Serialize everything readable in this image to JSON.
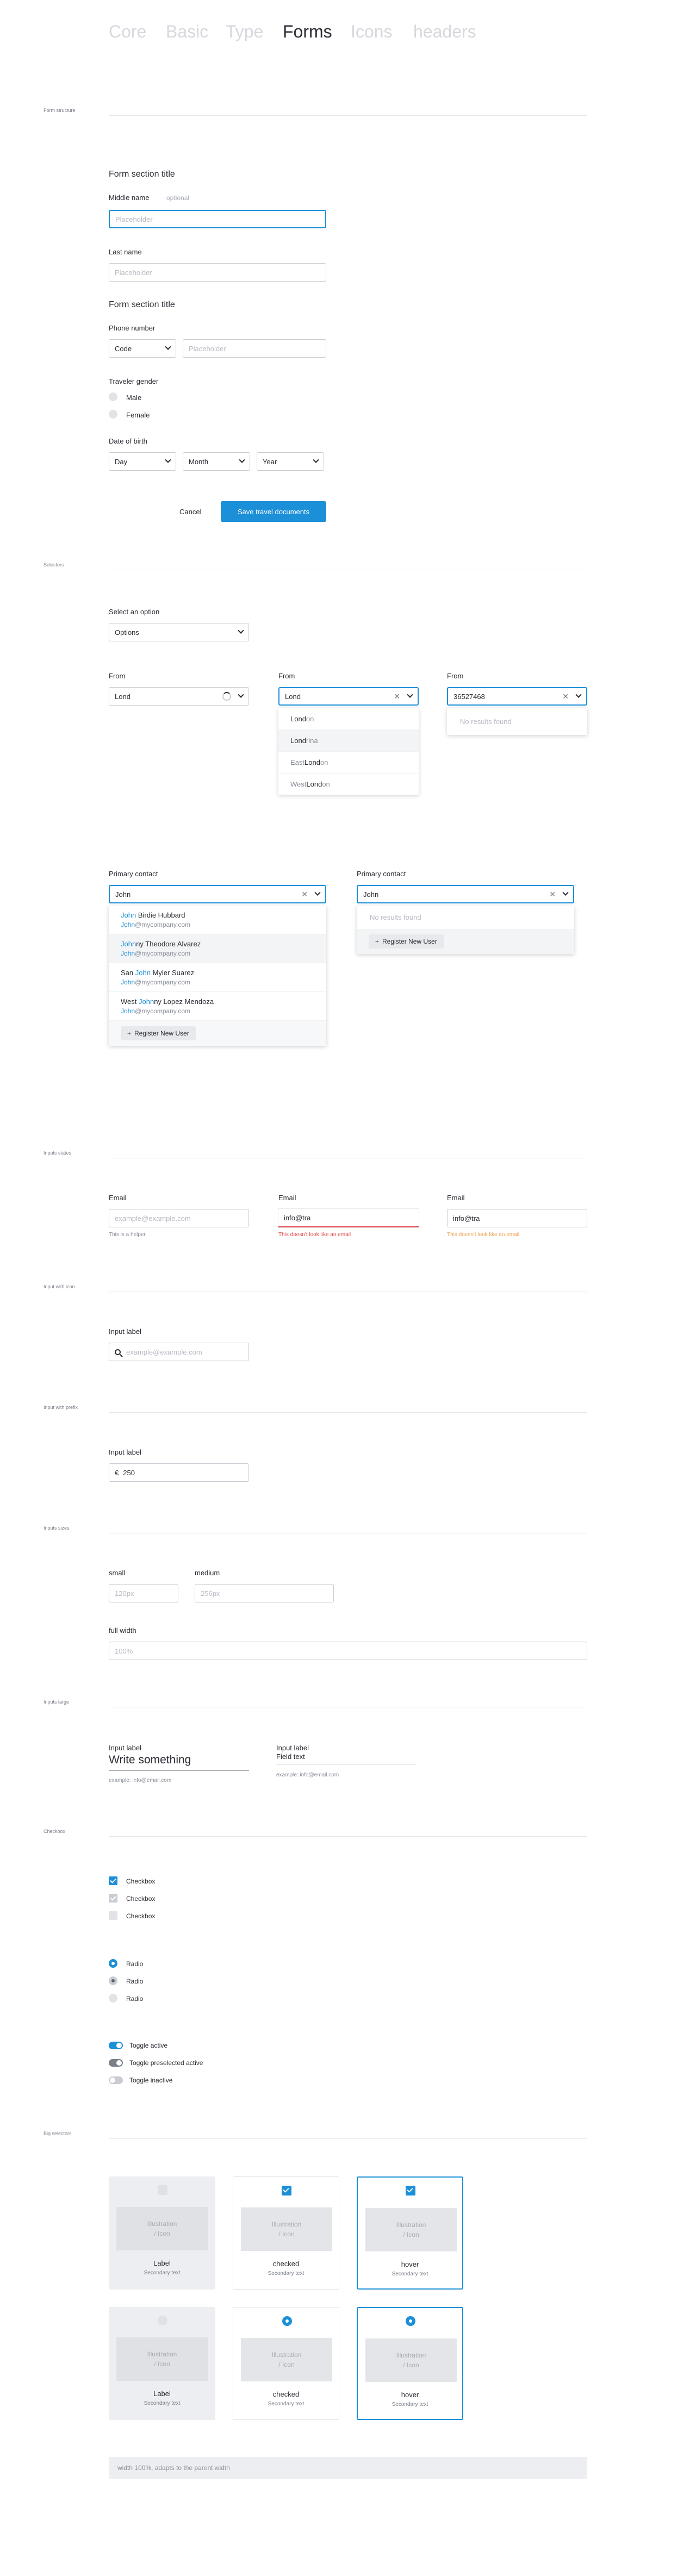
{
  "nav": {
    "tabs": [
      "Core",
      "Basic",
      "Type",
      "Forms",
      "Icons",
      "headers"
    ],
    "active": "Forms"
  },
  "sections": {
    "form_structure": "Form structure",
    "selectors": "Selectors",
    "inputs_states": "Inputs states",
    "input_with_icon": "Input with icon",
    "input_with_prefix": "Input with prefix",
    "inputs_sizes": "Inputs sizes",
    "inputs_large": "Inputs large",
    "checkbox": "Checkbox",
    "big_selectors": "Big selectors"
  },
  "form": {
    "section_title_1": "Form section title",
    "middle_name_label": "Middle name",
    "optional": "optional",
    "placeholder": "Placeholder",
    "last_name_label": "Last name",
    "section_title_2": "Form section title",
    "phone_label": "Phone number",
    "code": "Code",
    "gender_label": "Traveler gender",
    "male": "Male",
    "female": "Female",
    "dob_label": "Date of birth",
    "day": "Day",
    "month": "Month",
    "year": "Year",
    "cancel": "Cancel",
    "save": "Save travel documents"
  },
  "selectors": {
    "select_label": "Select an option",
    "options": "Options",
    "from_label": "From",
    "from_value_1": "Lond",
    "from_value_2": "Lond",
    "from_value_3": "36527468",
    "no_results": "No results found",
    "cities": [
      {
        "m": "Lond",
        "r": "on",
        "pre": ""
      },
      {
        "m": "Lond",
        "r": "rina",
        "pre": ""
      },
      {
        "m": "Lond",
        "r": "on",
        "pre": "East "
      },
      {
        "m": "Lond",
        "r": "on",
        "pre": "West "
      }
    ],
    "contact_label": "Primary contact",
    "contact_value": "John",
    "contacts": [
      {
        "pre": "",
        "j": "John",
        "post": " Birdie Hubbard",
        "email_j": "John",
        "email_rest": "@mycompany.com"
      },
      {
        "pre": "",
        "j": "John",
        "post": "ny Theodore Alvarez",
        "email_j": "John",
        "email_rest": "@mycompany.com"
      },
      {
        "pre": "San ",
        "j": "John",
        "post": " Myler Suarez",
        "email_j": "John",
        "email_rest": "@mycompany.com"
      },
      {
        "pre": "West ",
        "j": "John",
        "post": "ny Lopez Mendoza",
        "email_j": "John",
        "email_rest": "@mycompany.com"
      }
    ],
    "register": "Register New User"
  },
  "states": {
    "email_label": "Email",
    "placeholder": "example@example.com",
    "helper": "This is a helper",
    "value": "info@tra",
    "error": "This doesn't look like an email",
    "warning": "This doesn't look like an email"
  },
  "icon_input": {
    "label": "Input label",
    "placeholder": "example@example.com"
  },
  "prefix_input": {
    "label": "Input label",
    "prefix": "€",
    "value": "250"
  },
  "sizes": {
    "small": "small",
    "small_ph": "120px",
    "medium": "medium",
    "medium_ph": "256px",
    "full": "full width",
    "full_ph": "100%"
  },
  "large": {
    "label1": "Input label",
    "value1": "Write something",
    "helper1": "example: info@email.com",
    "label2": "Input label",
    "value2": "Field text",
    "helper2": "example: info@email.com"
  },
  "checkbox": {
    "items": [
      "Checkbox",
      "Checkbox",
      "Checkbox"
    ],
    "radios": [
      "Radio",
      "Radio",
      "Radio"
    ],
    "toggles": [
      "Toggle active",
      "Toggle preselected active",
      "Toggle inactive"
    ]
  },
  "big": {
    "illus1": "Illustration",
    "illus2": "/ Icon",
    "cards": [
      {
        "title": "Label",
        "sub": "Secondary text"
      },
      {
        "title": "checked",
        "sub": "Secondary text"
      },
      {
        "title": "hover",
        "sub": "Secondary text"
      }
    ],
    "footer": "width 100%, adapts to the parent width"
  },
  "colors": {
    "accent": "#1b8fd8",
    "error": "#e34a4a",
    "warning": "#f0a04b"
  }
}
